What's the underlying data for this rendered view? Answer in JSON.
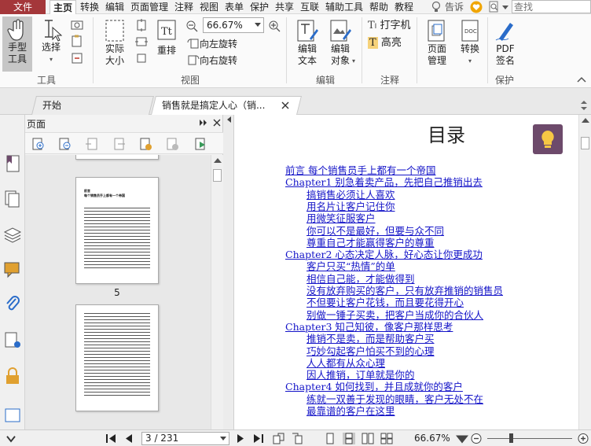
{
  "menu": {
    "file": "文件",
    "items": [
      "主页",
      "转换",
      "编辑",
      "页面管理",
      "注释",
      "视图",
      "表单",
      "保护",
      "共享",
      "互联",
      "辅助工具",
      "帮助",
      "教程"
    ],
    "tell_me": "告诉",
    "search_placeholder": "查找"
  },
  "ribbon": {
    "hand_tool": "手型\n工具",
    "select": "选择",
    "actual_size": "实际\n大小",
    "reflow": "重排",
    "zoom_value": "66.67%",
    "rotate_left": "向左旋转",
    "rotate_right": "向右旋转",
    "edit_text": "编辑\n文本",
    "edit_object": "编辑\n对象",
    "typewriter": "打字机",
    "highlight": "高亮",
    "page_manage": "页面\n管理",
    "convert": "转换",
    "pdf_sign": "PDF\n签名",
    "groups": [
      "工具",
      "视图",
      "编辑",
      "注释",
      "保护"
    ]
  },
  "tabs": [
    {
      "label": "开始"
    },
    {
      "label": "销售就是搞定人心（销..."
    }
  ],
  "panel": {
    "title": "页面",
    "thumbs": [
      {
        "label": "5",
        "heading_line1": "前言",
        "heading_line2": "每个销售员手上都有一个帝国"
      }
    ]
  },
  "document": {
    "title": "目录",
    "toc": [
      {
        "text": "前言 每个销售员手上都有一个帝国",
        "level": 0
      },
      {
        "text": "Chapter1 别急着卖产品，先把自己推销出去",
        "level": 0
      },
      {
        "text": "搞销售必须让人喜欢",
        "level": 1
      },
      {
        "text": "用名片让客户记住你",
        "level": 1
      },
      {
        "text": "用微笑征服客户",
        "level": 1
      },
      {
        "text": "你可以不是最好，但要与众不同",
        "level": 1
      },
      {
        "text": "尊重自己才能赢得客户的尊重",
        "level": 1
      },
      {
        "text": "Chapter2 心态决定人脉，好心态让你更成功",
        "level": 0
      },
      {
        "text": "客户只买“热情”的单",
        "level": 1
      },
      {
        "text": "相信自己能，才能做得到",
        "level": 1
      },
      {
        "text": "没有放弃购买的客户，只有放弃推销的销售员",
        "level": 1
      },
      {
        "text": "不但要让客户花钱，而且要花得开心",
        "level": 1
      },
      {
        "text": "别做一锤子买卖，把客户当成你的合伙人",
        "level": 1
      },
      {
        "text": "Chapter3 知己知彼，像客户那样思考",
        "level": 0
      },
      {
        "text": "推销不是卖，而是帮助客户买",
        "level": 1
      },
      {
        "text": "巧妙勾起客户怕买不到的心理",
        "level": 1
      },
      {
        "text": "人人都有从众心理",
        "level": 1
      },
      {
        "text": "因人推销，订单就是你的",
        "level": 1
      },
      {
        "text": "Chapter4 如何找到，并且成就你的客户",
        "level": 0
      },
      {
        "text": "练就一双善于发现的眼睛，客户无处不在",
        "level": 1
      },
      {
        "text": "最靠谱的客户在这里",
        "level": 1
      }
    ]
  },
  "status": {
    "page": "3 / 231",
    "zoom": "66.67%"
  }
}
